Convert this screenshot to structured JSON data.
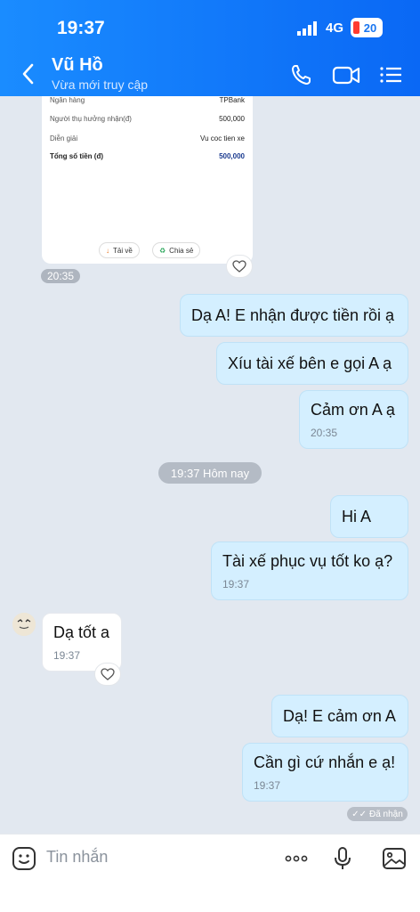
{
  "status_bar": {
    "time": "19:37",
    "network": "4G",
    "battery": "20"
  },
  "header": {
    "name": "Vũ Hồ",
    "status": "Vừa mới truy cập"
  },
  "receipt": {
    "rows": [
      {
        "label": "Ngân hàng",
        "value": "TPBank"
      },
      {
        "label": "Người thụ hưởng nhận(đ)",
        "value": "500,000"
      },
      {
        "label": "Diễn giải",
        "value": "Vu coc tien xe"
      }
    ],
    "total_label": "Tổng số tiền (đ)",
    "total_value": "500,000",
    "download_label": "Tải về",
    "share_label": "Chia sẻ",
    "time": "20:35"
  },
  "messages": [
    {
      "text": "Dạ A! E nhận được tiền rồi ạ"
    },
    {
      "text": "Xíu tài xế bên e gọi A ạ"
    },
    {
      "text": "Cảm ơn A ạ",
      "time": "20:35"
    },
    {
      "text": "Hi A"
    },
    {
      "text": "Tài xế phục vụ tốt ko ạ?",
      "time": "19:37"
    },
    {
      "text": "Dạ tốt a",
      "time": "19:37"
    },
    {
      "text": "Dạ! E cảm ơn A"
    },
    {
      "text": "Cần gì cứ nhắn e ạ!",
      "time": "19:37"
    }
  ],
  "day_separator": "19:37 Hôm nay",
  "seen_label": "Đã nhận",
  "input": {
    "placeholder": "Tin nhắn"
  },
  "icons": {
    "back": "chevron-left-icon",
    "call": "phone-icon",
    "video": "video-icon",
    "menu": "list-icon",
    "sticker": "sticker-icon",
    "more": "more-dots-icon",
    "mic": "microphone-icon",
    "image": "image-icon"
  },
  "colors": {
    "header": "#1a8cff",
    "my_bubble": "#d4efff",
    "their_bubble": "#ffffff"
  }
}
